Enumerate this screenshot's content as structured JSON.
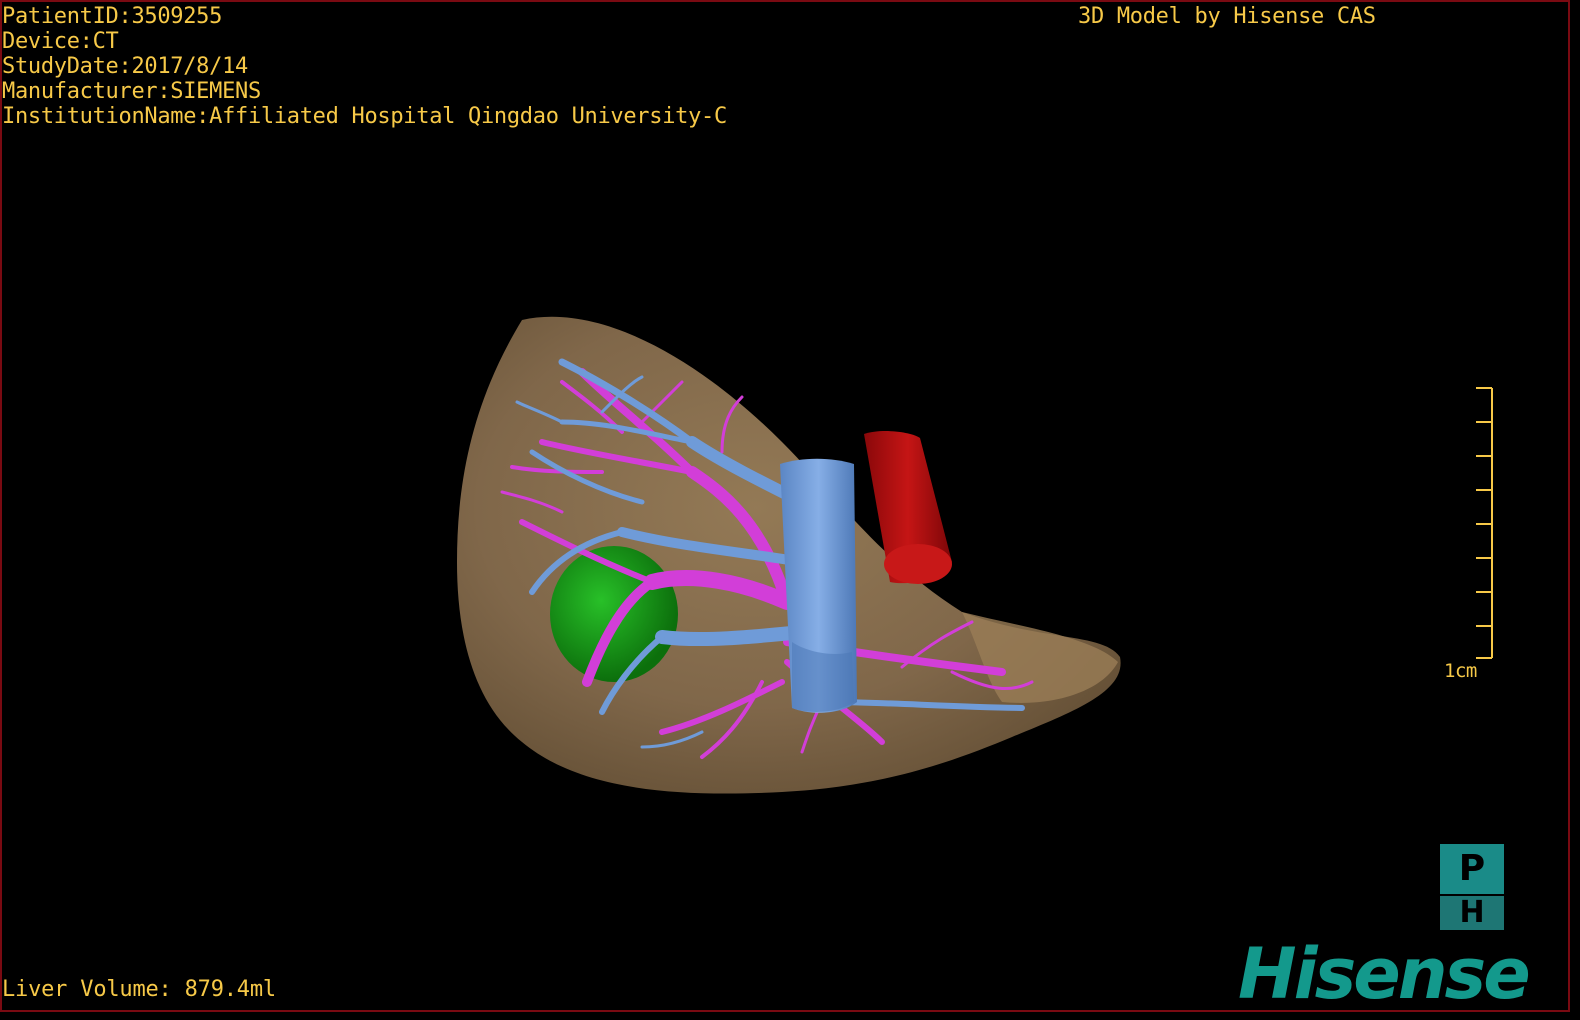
{
  "header": {
    "patient_id": "PatientID:3509255",
    "device": "Device:CT",
    "study_date": "StudyDate:2017/8/14",
    "manufacturer": "Manufacturer:SIEMENS",
    "institution": "InstitutionName:Affiliated Hospital Qingdao University-C",
    "credit": "3D Model by Hisense CAS"
  },
  "footer": {
    "liver_volume": "Liver Volume: 879.4ml"
  },
  "scale": {
    "label": "1cm"
  },
  "orientation": {
    "top_label": "P",
    "bottom_label": "H"
  },
  "brand": {
    "logo": "Hisense"
  },
  "colors": {
    "overlay_text": "#f7c948",
    "liver": "#8b7050",
    "hepatic_vein": "#6f9bd8",
    "portal_vein": "#d23ed8",
    "tumor": "#1da11d",
    "artery": "#b00d10",
    "logo": "#13998c",
    "frame": "#7a0a12"
  }
}
